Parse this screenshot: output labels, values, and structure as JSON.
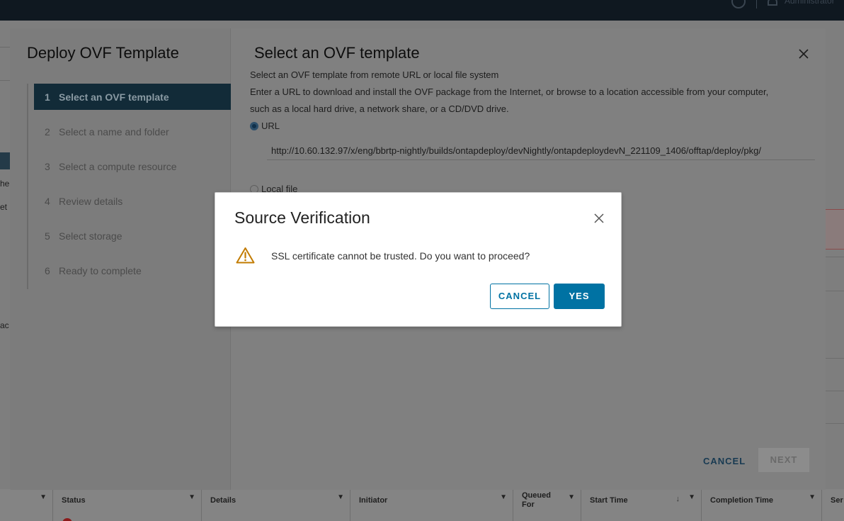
{
  "background": {
    "topbar": {
      "user_text": "Administrator"
    },
    "side_fragments": [
      "he",
      "et",
      "ac"
    ],
    "table_headers": [
      {
        "label": "Status"
      },
      {
        "label": "Details"
      },
      {
        "label": "Initiator"
      },
      {
        "label": "Queued For"
      },
      {
        "label": "Start Time",
        "sort": "descending"
      },
      {
        "label": "Completion Time"
      },
      {
        "label": "Ser"
      }
    ]
  },
  "wizard": {
    "title": "Deploy OVF Template",
    "steps": [
      {
        "number": "1",
        "label": "Select an OVF template",
        "active": true
      },
      {
        "number": "2",
        "label": "Select a name and folder"
      },
      {
        "number": "3",
        "label": "Select a compute resource"
      },
      {
        "number": "4",
        "label": "Review details"
      },
      {
        "number": "5",
        "label": "Select storage"
      },
      {
        "number": "6",
        "label": "Ready to complete"
      }
    ],
    "content": {
      "title": "Select an OVF template",
      "subtitle": "Select an OVF template from remote URL or local file system",
      "description_line1": "Enter a URL to download and install the OVF package from the Internet, or browse to a location accessible from your computer,",
      "description_line2": "such as a local hard drive, a network share, or a CD/DVD drive.",
      "url_option_label": "URL",
      "url_value": "http://10.60.132.97/x/eng/bbrtp-nightly/builds/ontapdeploy/devNightly/ontapdeploydevN_221109_1406/offtap/deploy/pkg/",
      "local_file_label": "Local file",
      "selected_option": "URL"
    },
    "cancel_label": "CANCEL",
    "next_label": "NEXT"
  },
  "dialog": {
    "title": "Source Verification",
    "message": "SSL certificate cannot be trusted. Do you want to proceed?",
    "cancel_label": "CANCEL",
    "yes_label": "YES",
    "icon": "warning-triangle-icon",
    "warning_color": "#c27b00",
    "primary_color": "#0072a3"
  }
}
